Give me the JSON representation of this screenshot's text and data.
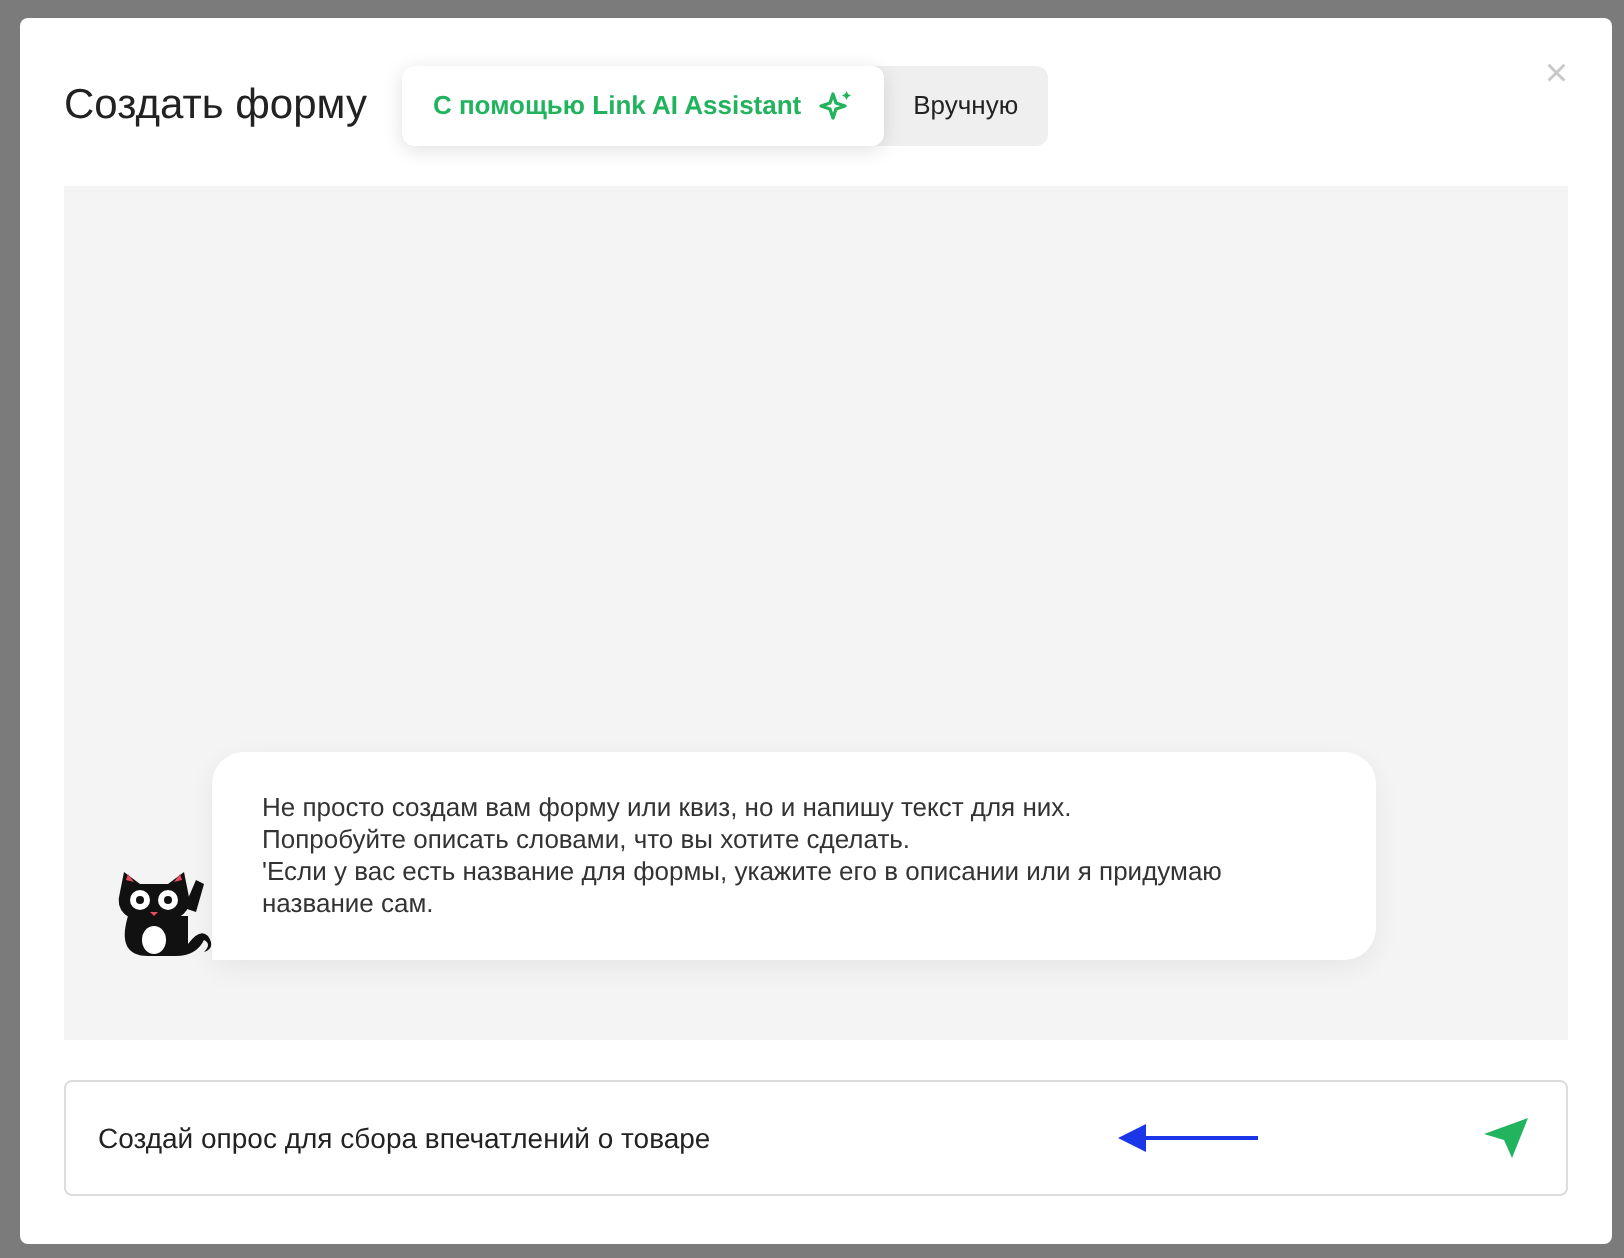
{
  "dialog": {
    "title": "Создать форму",
    "close": "×"
  },
  "tabs": [
    {
      "label": "С помощью Link AI Assistant",
      "selected": true
    },
    {
      "label": "Вручную",
      "selected": false
    }
  ],
  "chat": {
    "message": "Не просто создам вам форму или квиз, но и напишу текст для них.\nПопробуйте описать словами, что вы хотите сделать.\n'Если у вас есть название для формы, укажите его в описании или я придумаю название сам."
  },
  "input": {
    "value": "Создай опрос для сбора впечатлений о товаре"
  }
}
